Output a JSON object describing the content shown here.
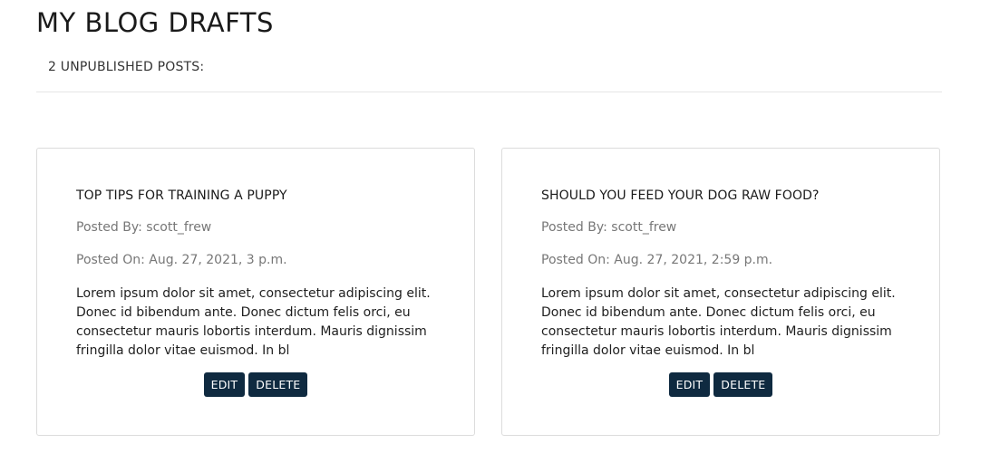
{
  "page": {
    "title": "MY BLOG DRAFTS",
    "count_label": "2 UNPUBLISHED POSTS:"
  },
  "posts": [
    {
      "title": "TOP TIPS FOR TRAINING A PUPPY",
      "posted_by": "Posted By: scott_frew",
      "posted_on": "Posted On: Aug. 27, 2021, 3 p.m.",
      "excerpt": "Lorem ipsum dolor sit amet, consectetur adipiscing elit. Donec id bibendum ante. Donec dictum felis orci, eu consectetur mauris lobortis interdum. Mauris dignissim fringilla dolor vitae euismod. In bl",
      "edit_label": "EDIT",
      "delete_label": "DELETE"
    },
    {
      "title": "SHOULD YOU FEED YOUR DOG RAW FOOD?",
      "posted_by": "Posted By: scott_frew",
      "posted_on": "Posted On: Aug. 27, 2021, 2:59 p.m.",
      "excerpt": "Lorem ipsum dolor sit amet, consectetur adipiscing elit. Donec id bibendum ante. Donec dictum felis orci, eu consectetur mauris lobortis interdum. Mauris dignissim fringilla dolor vitae euismod. In bl",
      "edit_label": "EDIT",
      "delete_label": "DELETE"
    }
  ],
  "colors": {
    "button_bg": "#0f2a40",
    "button_text": "#ffffff",
    "meta_text": "#777777"
  }
}
